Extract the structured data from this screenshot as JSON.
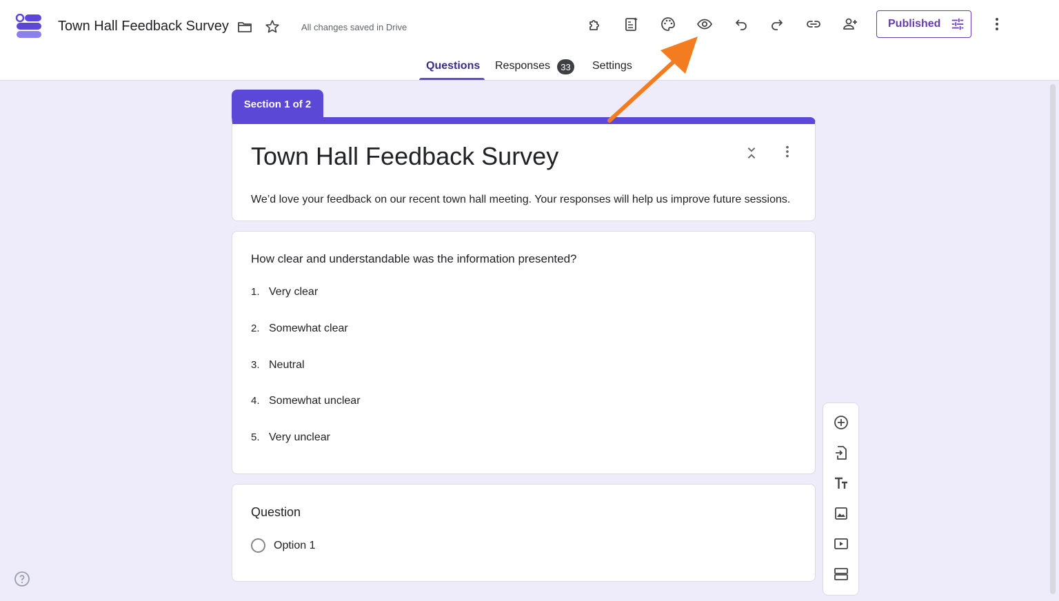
{
  "header": {
    "doc_title": "Town Hall Feedback Survey",
    "save_status": "All changes saved in Drive",
    "publish_label": "Published",
    "toolbar_icons": [
      "addons-icon",
      "ai-generate-icon",
      "palette-icon",
      "preview-eye-icon",
      "undo-icon",
      "redo-icon",
      "link-icon",
      "add-collaborator-icon",
      "more-vert-icon"
    ]
  },
  "tabs": [
    {
      "label": "Questions",
      "active": true
    },
    {
      "label": "Responses",
      "count": "33"
    },
    {
      "label": "Settings"
    }
  ],
  "section": {
    "label": "Section 1 of 2"
  },
  "form": {
    "title": "Town Hall Feedback Survey",
    "description": "We’d love your feedback on our recent town hall meeting. Your responses will help us improve future sessions."
  },
  "question1": {
    "text": "How clear and understandable was the information presented?",
    "options": [
      {
        "num": "1.",
        "label": "Very clear"
      },
      {
        "num": "2.",
        "label": "Somewhat clear"
      },
      {
        "num": "3.",
        "label": "Neutral"
      },
      {
        "num": "4.",
        "label": "Somewhat unclear"
      },
      {
        "num": "5.",
        "label": "Very unclear"
      }
    ]
  },
  "question2": {
    "title": "Question",
    "option": "Option 1"
  },
  "side_toolbar": [
    "add-question-icon",
    "import-questions-icon",
    "add-title-icon",
    "add-image-icon",
    "add-video-icon",
    "add-section-icon"
  ],
  "colors": {
    "accent": "#5b48d6",
    "publish": "#673ab7",
    "background": "#eeecfa",
    "arrow": "#f47c20"
  }
}
